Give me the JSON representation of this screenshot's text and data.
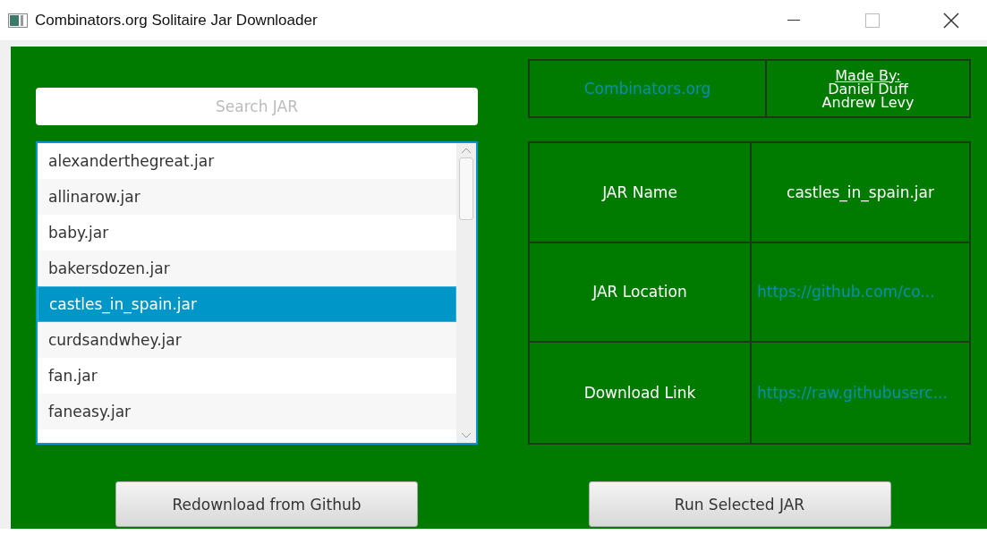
{
  "window": {
    "title": "Combinators.org Solitaire Jar Downloader"
  },
  "search": {
    "placeholder": "Search JAR"
  },
  "jar_list": [
    {
      "label": "alexanderthegreat.jar",
      "selected": false
    },
    {
      "label": "allinarow.jar",
      "selected": false
    },
    {
      "label": "baby.jar",
      "selected": false
    },
    {
      "label": "bakersdozen.jar",
      "selected": false
    },
    {
      "label": "castles_in_spain.jar",
      "selected": true
    },
    {
      "label": "curdsandwhey.jar",
      "selected": false
    },
    {
      "label": "fan.jar",
      "selected": false
    },
    {
      "label": "faneasy.jar",
      "selected": false
    }
  ],
  "header": {
    "link": "Combinators.org",
    "made_by_label": "Made By:",
    "authors": [
      "Daniel Duff",
      "Andrew Levy"
    ]
  },
  "details": [
    {
      "label": "JAR Name",
      "value": "castles_in_spain.jar",
      "kind": "text"
    },
    {
      "label": "JAR Location",
      "value": "https://github.com/co...",
      "kind": "link"
    },
    {
      "label": "Download Link",
      "value": "https://raw.githubuserc...",
      "kind": "link"
    }
  ],
  "buttons": [
    "Redownload from Github",
    "Run Selected JAR"
  ]
}
